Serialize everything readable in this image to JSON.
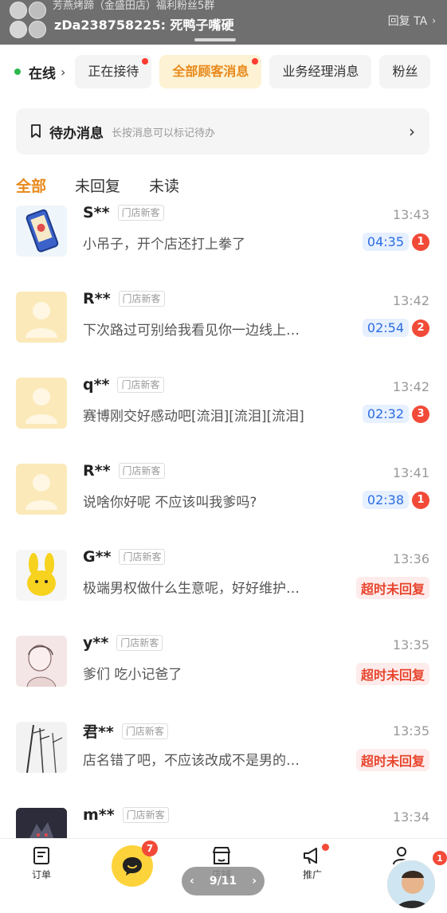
{
  "notification": {
    "group_name": "芳燕烤蹄（金盛田店）福利粉丝5群",
    "message": "zDa238758225: 死鸭子嘴硬",
    "reply_label": "回复 TA"
  },
  "status": {
    "label": "在线"
  },
  "category_tabs": [
    {
      "label": "正在接待",
      "has_dot": true
    },
    {
      "label": "全部顾客消息",
      "has_dot": true,
      "active": true
    },
    {
      "label": "业务经理消息",
      "has_dot": false
    },
    {
      "label": "粉丝",
      "has_dot": false
    }
  ],
  "pending": {
    "title": "待办消息",
    "hint": "长按消息可以标记待办"
  },
  "filters": [
    {
      "label": "全部",
      "active": true
    },
    {
      "label": "未回复",
      "active": false
    },
    {
      "label": "未读",
      "active": false
    }
  ],
  "conversations": [
    {
      "name": "S**",
      "tag": "门店新客",
      "time": "13:43",
      "preview": "小吊子，开个店还打上拳了",
      "timer": "04:35",
      "unread": "1",
      "status": ""
    },
    {
      "name": "R**",
      "tag": "门店新客",
      "time": "13:42",
      "preview": "下次路过可别给我看见你一边线上…",
      "timer": "02:54",
      "unread": "2",
      "status": ""
    },
    {
      "name": "q**",
      "tag": "门店新客",
      "time": "13:42",
      "preview": "赛博刚交好感动吧[流泪][流泪][流泪]",
      "timer": "02:32",
      "unread": "3",
      "status": ""
    },
    {
      "name": "R**",
      "tag": "门店新客",
      "time": "13:41",
      "preview": "说啥你好呢 不应该叫我爹吗?",
      "timer": "02:38",
      "unread": "1",
      "status": ""
    },
    {
      "name": "G**",
      "tag": "门店新客",
      "time": "13:36",
      "preview": "极端男权做什么生意呢，好好维护…",
      "timer": "",
      "unread": "",
      "status": "超时未回复"
    },
    {
      "name": "y**",
      "tag": "门店新客",
      "time": "13:35",
      "preview": "爹们 吃小记爸了",
      "timer": "",
      "unread": "",
      "status": "超时未回复"
    },
    {
      "name": "君**",
      "tag": "门店新客",
      "time": "13:35",
      "preview": "店名错了吧，不应该改成不是男的…",
      "timer": "",
      "unread": "",
      "status": "超时未回复"
    },
    {
      "name": "m**",
      "tag": "门店新客",
      "time": "13:34",
      "preview": "",
      "timer": "",
      "unread": "",
      "status": ""
    }
  ],
  "bottom_nav": {
    "orders_label": "订单",
    "messages_badge": "7",
    "store_label": "店铺",
    "promo_label": "推广",
    "me_label": "我的"
  },
  "pager": {
    "text": "9/11"
  },
  "floating_badge": "1",
  "colors": {
    "accent": "#e8891a",
    "timer_blue": "#2b6de0",
    "badge_red": "#f24a38",
    "online_green": "#2db84d",
    "center_yellow": "#fdd33c"
  }
}
